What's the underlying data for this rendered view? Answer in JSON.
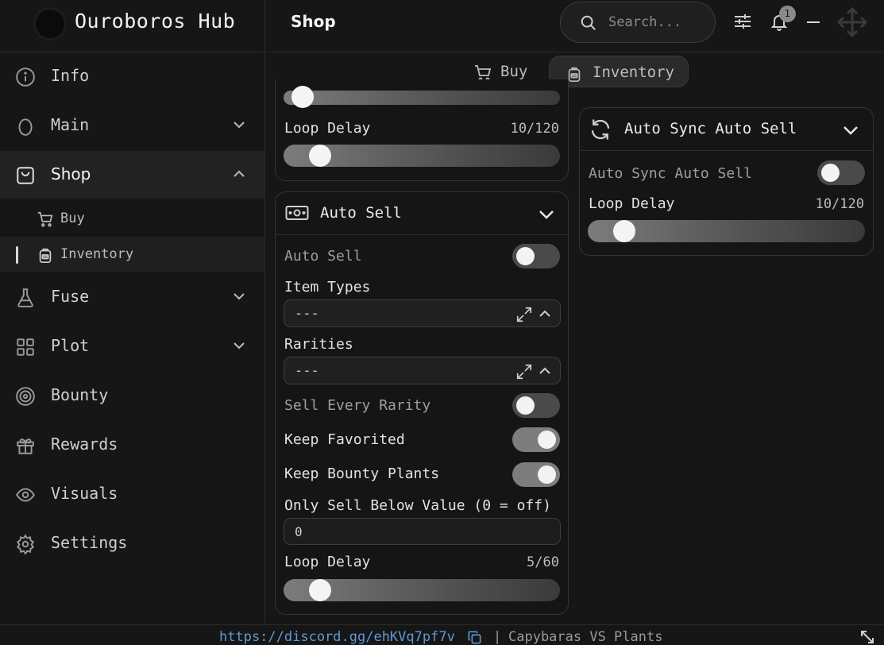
{
  "app": {
    "title": "Ouroboros Hub",
    "page_title": "Shop"
  },
  "search": {
    "placeholder": "Search..."
  },
  "toolbar": {
    "notification_count": "1"
  },
  "sidebar": {
    "items": [
      {
        "label": "Info",
        "icon": "info-icon"
      },
      {
        "label": "Main",
        "icon": "egg-icon"
      },
      {
        "label": "Shop",
        "icon": "shopping-bag-icon"
      },
      {
        "label": "Fuse",
        "icon": "flask-icon"
      },
      {
        "label": "Plot",
        "icon": "grid-icon"
      },
      {
        "label": "Bounty",
        "icon": "target-icon"
      },
      {
        "label": "Rewards",
        "icon": "gift-icon"
      },
      {
        "label": "Visuals",
        "icon": "eye-icon"
      },
      {
        "label": "Settings",
        "icon": "gear-icon"
      }
    ],
    "shop_sub": [
      {
        "label": "Buy",
        "icon": "cart-icon"
      },
      {
        "label": "Inventory",
        "icon": "backpack-icon"
      }
    ]
  },
  "tabs": [
    {
      "label": "Buy",
      "icon": "cart-icon"
    },
    {
      "label": "Inventory",
      "icon": "backpack-icon"
    }
  ],
  "top_card": {
    "loop_delay_label": "Loop Delay",
    "loop_delay_value": "10/120",
    "loop_delay_fraction": 0.083
  },
  "auto_sell": {
    "title": "Auto Sell",
    "toggle_label": "Auto Sell",
    "toggle_on": false,
    "item_types_label": "Item Types",
    "item_types_value": "---",
    "rarities_label": "Rarities",
    "rarities_value": "---",
    "sell_every_rarity_label": "Sell Every Rarity",
    "sell_every_rarity_on": false,
    "keep_favorited_label": "Keep Favorited",
    "keep_favorited_on": true,
    "keep_bounty_label": "Keep Bounty Plants",
    "keep_bounty_on": true,
    "below_value_label": "Only Sell Below Value (0 = off)",
    "below_value": "0",
    "loop_delay_label": "Loop Delay",
    "loop_delay_value": "5/60",
    "loop_delay_fraction": 0.083
  },
  "auto_sync": {
    "title": "Auto Sync Auto Sell",
    "toggle_label": "Auto Sync Auto Sell",
    "toggle_on": false,
    "loop_delay_label": "Loop Delay",
    "loop_delay_value": "10/120",
    "loop_delay_fraction": 0.083
  },
  "footer": {
    "link": "https://discord.gg/ehKVq7pf7v",
    "separator": "|",
    "game": "Capybaras VS Plants"
  }
}
